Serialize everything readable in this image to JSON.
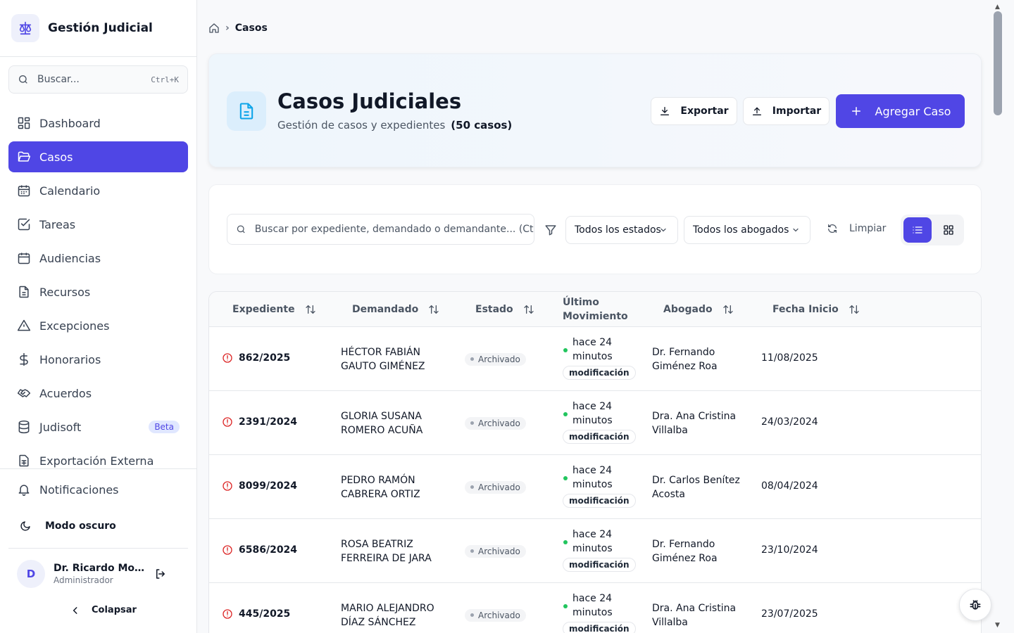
{
  "app": {
    "title": "Gestión Judicial"
  },
  "sidebar": {
    "search_placeholder": "Buscar...",
    "search_shortcut": "Ctrl+K",
    "items": [
      {
        "label": "Dashboard",
        "icon": "dashboard-icon"
      },
      {
        "label": "Casos",
        "icon": "folder-open-icon",
        "active": true
      },
      {
        "label": "Calendario",
        "icon": "calendar-icon"
      },
      {
        "label": "Tareas",
        "icon": "checkbox-icon"
      },
      {
        "label": "Audiencias",
        "icon": "calendar-icon"
      },
      {
        "label": "Recursos",
        "icon": "document-icon"
      },
      {
        "label": "Excepciones",
        "icon": "warning-icon"
      },
      {
        "label": "Honorarios",
        "icon": "dollar-icon"
      },
      {
        "label": "Acuerdos",
        "icon": "handshake-icon"
      },
      {
        "label": "Judisoft",
        "icon": "database-icon",
        "badge": "Beta"
      },
      {
        "label": "Exportación Externa",
        "icon": "spreadsheet-icon"
      }
    ],
    "notifications_label": "Notificaciones",
    "dark_mode_label": "Modo oscuro",
    "user": {
      "initial": "D",
      "name": "Dr. Ricardo Moral...",
      "role": "Administrador"
    },
    "collapse_label": "Colapsar"
  },
  "breadcrumb": {
    "current": "Casos"
  },
  "header": {
    "title": "Casos Judiciales",
    "subtitle": "Gestión de casos y expedientes",
    "count": "(50 casos)",
    "export_label": "Exportar",
    "import_label": "Importar",
    "add_label": "Agregar Caso"
  },
  "filters": {
    "search_placeholder": "Buscar por expediente, demandado o demandante... (Ctrl+K)",
    "status_select": "Todos los estados",
    "lawyer_select": "Todos los abogados",
    "clear_label": "Limpiar"
  },
  "table": {
    "columns": [
      "Expediente",
      "Demandado",
      "Estado",
      "Último Movimiento",
      "Abogado",
      "Fecha Inicio"
    ],
    "rows": [
      {
        "expediente": "862/2025",
        "demandado": "HÉCTOR FABIÁN GAUTO GIMÉNEZ",
        "estado": "Archivado",
        "movimiento": "hace 24 minutos",
        "tipo": "modificación",
        "abogado": "Dr. Fernando Giménez Roa",
        "fecha": "11/08/2025"
      },
      {
        "expediente": "2391/2024",
        "demandado": "GLORIA SUSANA ROMERO ACUÑA",
        "estado": "Archivado",
        "movimiento": "hace 24 minutos",
        "tipo": "modificación",
        "abogado": "Dra. Ana Cristina Villalba",
        "fecha": "24/03/2024"
      },
      {
        "expediente": "8099/2024",
        "demandado": "PEDRO RAMÓN CABRERA ORTIZ",
        "estado": "Archivado",
        "movimiento": "hace 24 minutos",
        "tipo": "modificación",
        "abogado": "Dr. Carlos Benítez Acosta",
        "fecha": "08/04/2024"
      },
      {
        "expediente": "6586/2024",
        "demandado": "ROSA BEATRIZ FERREIRA DE JARA",
        "estado": "Archivado",
        "movimiento": "hace 24 minutos",
        "tipo": "modificación",
        "abogado": "Dr. Fernando Giménez Roa",
        "fecha": "23/10/2024"
      },
      {
        "expediente": "445/2025",
        "demandado": "MARIO ALEJANDRO DÍAZ SÁNCHEZ",
        "estado": "Archivado",
        "movimiento": "hace 24 minutos",
        "tipo": "modificación",
        "abogado": "Dra. Ana Cristina Villalba",
        "fecha": "23/07/2025"
      }
    ]
  },
  "colors": {
    "accent": "#4f46e5",
    "status_dot": "#22c55e",
    "alert": "#dc2626"
  }
}
